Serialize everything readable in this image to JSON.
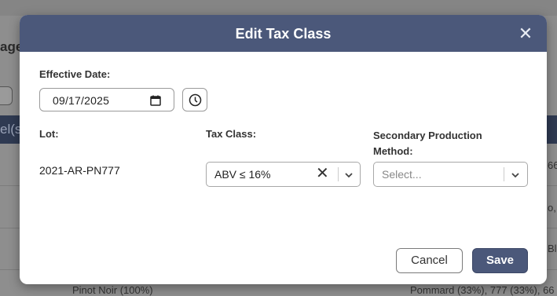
{
  "background": {
    "header_fragment": "age",
    "band_fragment": "el(s",
    "right_cells": [
      "66",
      "o, L",
      "Bl",
      "Pommard (33%), 777 (33%), 66"
    ],
    "bottom_left_cell": "Pinot Noir (100%)"
  },
  "modal": {
    "title": "Edit Tax Class",
    "close_icon": "close-icon",
    "effective_date_label": "Effective Date:",
    "effective_date_value": "09/17/2025",
    "lot_label": "Lot:",
    "lot_value": "2021-AR-PN777",
    "tax_class_label": "Tax Class:",
    "tax_class_value": "ABV ≤ 16%",
    "secondary_label": "Secondary Production Method:",
    "secondary_placeholder": "Select...",
    "cancel_label": "Cancel",
    "save_label": "Save"
  },
  "colors": {
    "header_bg": "#4b587a",
    "save_bg": "#4b587a",
    "overlay": "#8e8e8e"
  }
}
